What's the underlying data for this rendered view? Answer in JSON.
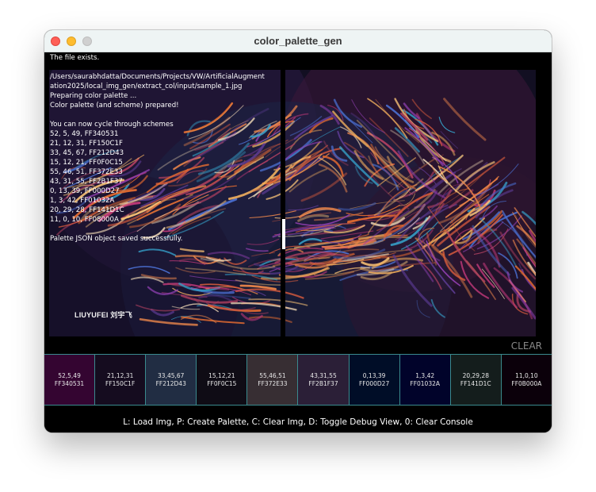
{
  "window": {
    "title": "color_palette_gen"
  },
  "console": {
    "lines": [
      "The file exists.",
      "",
      "/Users/saurabhdatta/Documents/Projects/VW/ArtificialAugment",
      "ation2025/local_img_gen/extract_col/input/sample_1.jpg",
      "Preparing color palette ...",
      "Color palette (and scheme) prepared!",
      "",
      "You can now cycle through schemes",
      "52, 5, 49, FF340531",
      "21, 12, 31, FF150C1F",
      "33, 45, 67, FF212D43",
      "15, 12, 21, FF0F0C15",
      "55, 46, 51, FF372E33",
      "43, 31, 55, FF2B1F37",
      "0, 13, 39, FF000D27",
      "1, 3, 42, FF01032A",
      "20, 29, 28, FF141D1C",
      "11, 0, 10, FF08000A",
      "",
      "Palette JSON object saved successfully."
    ]
  },
  "image": {
    "watermark": "LIUYUFEI 刘宇飞"
  },
  "clear_label": "CLEAR",
  "palette": {
    "swatches": [
      {
        "rgb": "52,5,49",
        "hex": "FF340531",
        "color": "#340531"
      },
      {
        "rgb": "21,12,31",
        "hex": "FF150C1F",
        "color": "#150C1F"
      },
      {
        "rgb": "33,45,67",
        "hex": "FF212D43",
        "color": "#212D43"
      },
      {
        "rgb": "15,12,21",
        "hex": "FF0F0C15",
        "color": "#0F0C15"
      },
      {
        "rgb": "55,46,51",
        "hex": "FF372E33",
        "color": "#372E33"
      },
      {
        "rgb": "43,31,55",
        "hex": "FF2B1F37",
        "color": "#2B1F37"
      },
      {
        "rgb": "0,13,39",
        "hex": "FF000D27",
        "color": "#000D27"
      },
      {
        "rgb": "1,3,42",
        "hex": "FF01032A",
        "color": "#01032A"
      },
      {
        "rgb": "20,29,28",
        "hex": "FF141D1C",
        "color": "#141D1C"
      },
      {
        "rgb": "11,0,10",
        "hex": "FF0B000A",
        "color": "#0B000A"
      }
    ]
  },
  "footer": {
    "help": "L: Load Img,  P: Create Palette,  C: Clear Img,  D: Toggle Debug View,  0: Clear Console"
  },
  "colors": {
    "accent_border": "#3a8a8e",
    "clear_label": "#8a8a8a"
  }
}
